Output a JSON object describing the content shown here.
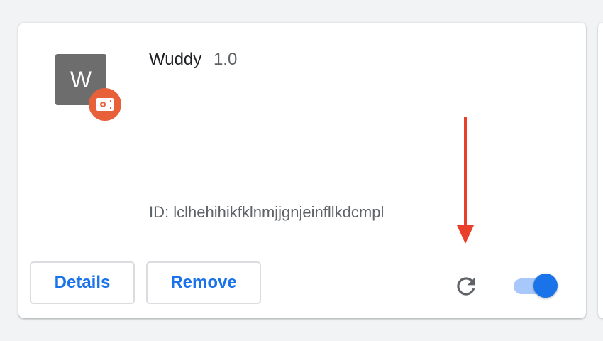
{
  "extension": {
    "icon_letter": "W",
    "name": "Wuddy",
    "version": "1.0",
    "id_text": "ID: lclhehihikfklnmjjgnjeinfllkdcmpl",
    "enabled": true
  },
  "actions": {
    "details_label": "Details",
    "remove_label": "Remove"
  },
  "icons": {
    "badge": "policy-badge-icon",
    "reload": "reload-icon",
    "annotation": "annotation-arrow"
  },
  "colors": {
    "accent": "#1a73e8",
    "badge": "#e8603a",
    "annotation_arrow": "#e8402a",
    "icon_bg": "#6d6d6d"
  }
}
